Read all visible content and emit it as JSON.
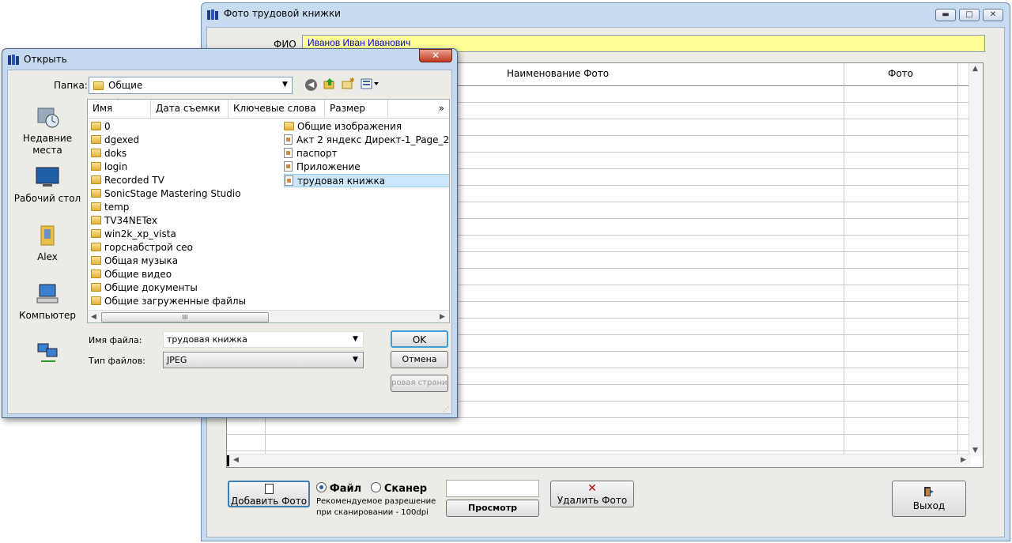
{
  "main": {
    "title": "Фото трудовой книжки",
    "fio_label": "ФИО",
    "fio_value": "Иванов Иван Иванович",
    "col_name": "Наименование Фото",
    "col_photo": "Фото",
    "add_button": "Добавить Фото",
    "radio_file": "Файл",
    "radio_scanner": "Сканер",
    "scan_hint_1": "Рекомендуемое разрешение",
    "scan_hint_2": "при сканировании - 100dpi",
    "view_button": "Просмотр",
    "delete_button": "Удалить Фото",
    "exit_button": "Выход"
  },
  "dialog": {
    "title": "Открыть",
    "folder_label": "Папка:",
    "folder_value": "Общие",
    "places": [
      "Недавние места",
      "Рабочий стол",
      "Alex",
      "Компьютер"
    ],
    "columns": [
      "Имя",
      "Дата съемки",
      "Ключевые слова",
      "Размер",
      "»"
    ],
    "left_items": [
      "0",
      "dgexed",
      "doks",
      "login",
      "Recorded TV",
      "SonicStage Mastering Studio",
      "temp",
      "TV34NETex",
      "win2k_xp_vista",
      "горснабстрой сео",
      "Общая музыка",
      "Общие видео",
      "Общие документы",
      "Общие загруженные файлы"
    ],
    "right_items": [
      "Общие изображения",
      "Акт 2 яндекс Директ-1_Page_2",
      "паспорт",
      "Приложение",
      "трудовая книжка"
    ],
    "filename_label": "Имя файла:",
    "filename_value": "трудовая книжка",
    "filetype_label": "Тип файлов:",
    "filetype_value": "JPEG",
    "ok_button": "OK",
    "cancel_button": "Отмена",
    "extra_button": "ровая страниц",
    "hscroll_thumb": "III"
  },
  "colors": {
    "fio_bg": "#ffff99",
    "window_frame": "#c7dcf1",
    "selected_row": "#cce8ff"
  }
}
